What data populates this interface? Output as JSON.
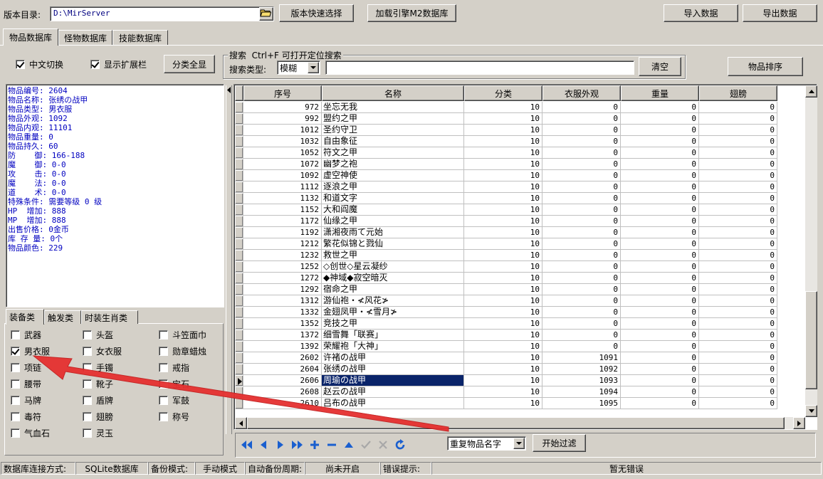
{
  "top": {
    "version_dir_label": "版本目录:",
    "version_dir_value": "D:\\MirServer",
    "quick_select_label": "版本快速选择",
    "load_m2_label": "加载引擎M2数据库",
    "import_label": "导入数据",
    "export_label": "导出数据"
  },
  "tabs": [
    "物品数据库",
    "怪物数据库",
    "技能数据库"
  ],
  "options": {
    "chinese_switch_label": "中文切换",
    "show_ext_label": "显示扩展栏",
    "show_all_label": "分类全显"
  },
  "search": {
    "group_title": "搜索  Ctrl+F 可打开定位搜索",
    "type_label": "搜索类型:",
    "type_value": "模糊",
    "query_value": "",
    "clear_label": "清空",
    "sort_label": "物品排序"
  },
  "info_lines": [
    "物品编号: 2604",
    "物品名称: 张绣の战甲",
    "物品类型: 男衣服",
    "物品外观: 1092",
    "物品内观: 11101",
    "物品重量: 0",
    "物品持久: 60",
    "防    御: 166-188",
    "魔    御: 0-0",
    "攻    击: 0-0",
    "魔    法: 0-0",
    "道    术: 0-0",
    "特殊条件: 需要等级 0 级",
    "HP  增加: 888",
    "MP  增加: 888",
    "出售价格: 0金币",
    "库 存 量: 0个",
    "物品颜色: 229"
  ],
  "category_tabs": [
    "装备类",
    "触发类",
    "时装生肖类"
  ],
  "categories": [
    {
      "label": "武器",
      "checked": false
    },
    {
      "label": "头盔",
      "checked": false
    },
    {
      "label": "斗笠面巾",
      "checked": false
    },
    {
      "label": "男衣服",
      "checked": true
    },
    {
      "label": "女衣服",
      "checked": false
    },
    {
      "label": "勋章蜡烛",
      "checked": false
    },
    {
      "label": "项链",
      "checked": false
    },
    {
      "label": "手镯",
      "checked": false
    },
    {
      "label": "戒指",
      "checked": false
    },
    {
      "label": "腰带",
      "checked": false
    },
    {
      "label": "靴子",
      "checked": false
    },
    {
      "label": "宝石",
      "checked": false
    },
    {
      "label": "马牌",
      "checked": false
    },
    {
      "label": "盾牌",
      "checked": false
    },
    {
      "label": "军鼓",
      "checked": false
    },
    {
      "label": "毒符",
      "checked": false
    },
    {
      "label": "翅膀",
      "checked": false
    },
    {
      "label": "称号",
      "checked": false
    },
    {
      "label": "气血石",
      "checked": false
    },
    {
      "label": "灵玉",
      "checked": false
    }
  ],
  "grid": {
    "columns": [
      "序号",
      "名称",
      "分类",
      "衣服外观",
      "重量",
      "翅膀"
    ],
    "selected_index": 24,
    "rows": [
      [
        "972",
        "坐忘无我",
        "10",
        "0",
        "0",
        "0"
      ],
      [
        "992",
        "盟约之甲",
        "10",
        "0",
        "0",
        "0"
      ],
      [
        "1012",
        "圣约守卫",
        "10",
        "0",
        "0",
        "0"
      ],
      [
        "1032",
        "自由象征",
        "10",
        "0",
        "0",
        "0"
      ],
      [
        "1052",
        "符文之甲",
        "10",
        "0",
        "0",
        "0"
      ],
      [
        "1072",
        "幽梦之袍",
        "10",
        "0",
        "0",
        "0"
      ],
      [
        "1092",
        "虚空神使",
        "10",
        "0",
        "0",
        "0"
      ],
      [
        "1112",
        "逐浪之甲",
        "10",
        "0",
        "0",
        "0"
      ],
      [
        "1132",
        "和道文字",
        "10",
        "0",
        "0",
        "0"
      ],
      [
        "1152",
        "大和阎魔",
        "10",
        "0",
        "0",
        "0"
      ],
      [
        "1172",
        "仙缘之甲",
        "10",
        "0",
        "0",
        "0"
      ],
      [
        "1192",
        "潇湘夜雨て元始",
        "10",
        "0",
        "0",
        "0"
      ],
      [
        "1212",
        "繁花似锦と戮仙",
        "10",
        "0",
        "0",
        "0"
      ],
      [
        "1232",
        "救世之甲",
        "10",
        "0",
        "0",
        "0"
      ],
      [
        "1252",
        "◇创世◇星云凝纱",
        "10",
        "0",
        "0",
        "0"
      ],
      [
        "1272",
        "◆神域◆寂空暗灭",
        "10",
        "0",
        "0",
        "0"
      ],
      [
        "1292",
        "宿命之甲",
        "10",
        "0",
        "0",
        "0"
      ],
      [
        "1312",
        "游仙袍・≮风花≯",
        "10",
        "0",
        "0",
        "0"
      ],
      [
        "1332",
        "金翅凤甲・≮雪月≯",
        "10",
        "0",
        "0",
        "0"
      ],
      [
        "1352",
        "竞技之甲",
        "10",
        "0",
        "0",
        "0"
      ],
      [
        "1372",
        "细雪舞「联赛」",
        "10",
        "0",
        "0",
        "0"
      ],
      [
        "1392",
        "荣耀袍「大神」",
        "10",
        "0",
        "0",
        "0"
      ],
      [
        "2602",
        "许褚の战甲",
        "10",
        "1091",
        "0",
        "0"
      ],
      [
        "2604",
        "张绣の战甲",
        "10",
        "1092",
        "0",
        "0"
      ],
      [
        "2606",
        "周瑜の战甲",
        "10",
        "1093",
        "0",
        "0"
      ],
      [
        "2608",
        "赵云の战甲",
        "10",
        "1094",
        "0",
        "0"
      ],
      [
        "2610",
        "吕布の战甲",
        "10",
        "1095",
        "0",
        "0"
      ]
    ]
  },
  "filter": {
    "mode_value": "重复物品名字",
    "start_label": "开始过滤"
  },
  "nav_icons": [
    "first-icon",
    "prior-icon",
    "next-icon",
    "last-icon",
    "insert-icon",
    "delete-icon",
    "edit-icon",
    "post-icon",
    "cancel-icon",
    "refresh-icon"
  ],
  "status": {
    "db_conn_label": "数据库连接方式:",
    "db_conn_value": "SQLite数据库",
    "backup_label": "备份模式:",
    "backup_value": "手动模式",
    "auto_backup_label": "自动备份周期:",
    "auto_backup_value": "尚未开启",
    "error_label": "错误提示:",
    "error_value": "暂无错误"
  },
  "colors": {
    "face": "#d4d0c8",
    "info_text": "#0000c0",
    "path_text": "#000080",
    "selection": "#0a246a",
    "nav_blue": "#1a5fcf",
    "annotation_arrow": "#e53030"
  }
}
